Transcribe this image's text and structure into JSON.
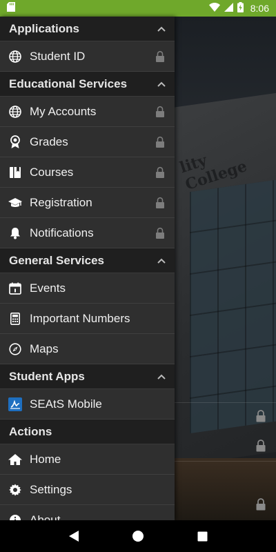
{
  "status_bar": {
    "time": "8:06"
  },
  "colors": {
    "status_bar": "#6fa82b",
    "drawer_bg": "#2f2f2f",
    "section_bg": "#1f1f1f",
    "seats_icon": "#1e6fc0"
  },
  "background": {
    "sign_text": "lity College"
  },
  "drawer": {
    "sections": [
      {
        "title": "Applications",
        "items": [
          {
            "label": "Student ID",
            "icon": "globe-icon",
            "locked": true
          }
        ]
      },
      {
        "title": "Educational Services",
        "items": [
          {
            "label": "My Accounts",
            "icon": "globe-icon",
            "locked": true
          },
          {
            "label": "Grades",
            "icon": "award-icon",
            "locked": true
          },
          {
            "label": "Courses",
            "icon": "book-icon",
            "locked": true
          },
          {
            "label": "Registration",
            "icon": "graduation-cap-icon",
            "locked": true
          },
          {
            "label": "Notifications",
            "icon": "bell-icon",
            "locked": true
          }
        ]
      },
      {
        "title": "General Services",
        "items": [
          {
            "label": "Events",
            "icon": "calendar-icon",
            "locked": false
          },
          {
            "label": "Important Numbers",
            "icon": "calculator-icon",
            "locked": false
          },
          {
            "label": "Maps",
            "icon": "compass-icon",
            "locked": false
          }
        ]
      },
      {
        "title": "Student Apps",
        "items": [
          {
            "label": "SEAtS Mobile",
            "icon": "seats-icon",
            "locked": false
          }
        ]
      },
      {
        "title": "Actions",
        "items": [
          {
            "label": "Home",
            "icon": "home-icon",
            "locked": false
          },
          {
            "label": "Settings",
            "icon": "gear-icon",
            "locked": false
          },
          {
            "label": "About",
            "icon": "info-icon",
            "locked": false
          }
        ]
      }
    ]
  },
  "nav_bar": {
    "buttons": [
      "back-icon",
      "home-circle-icon",
      "recents-icon"
    ]
  }
}
